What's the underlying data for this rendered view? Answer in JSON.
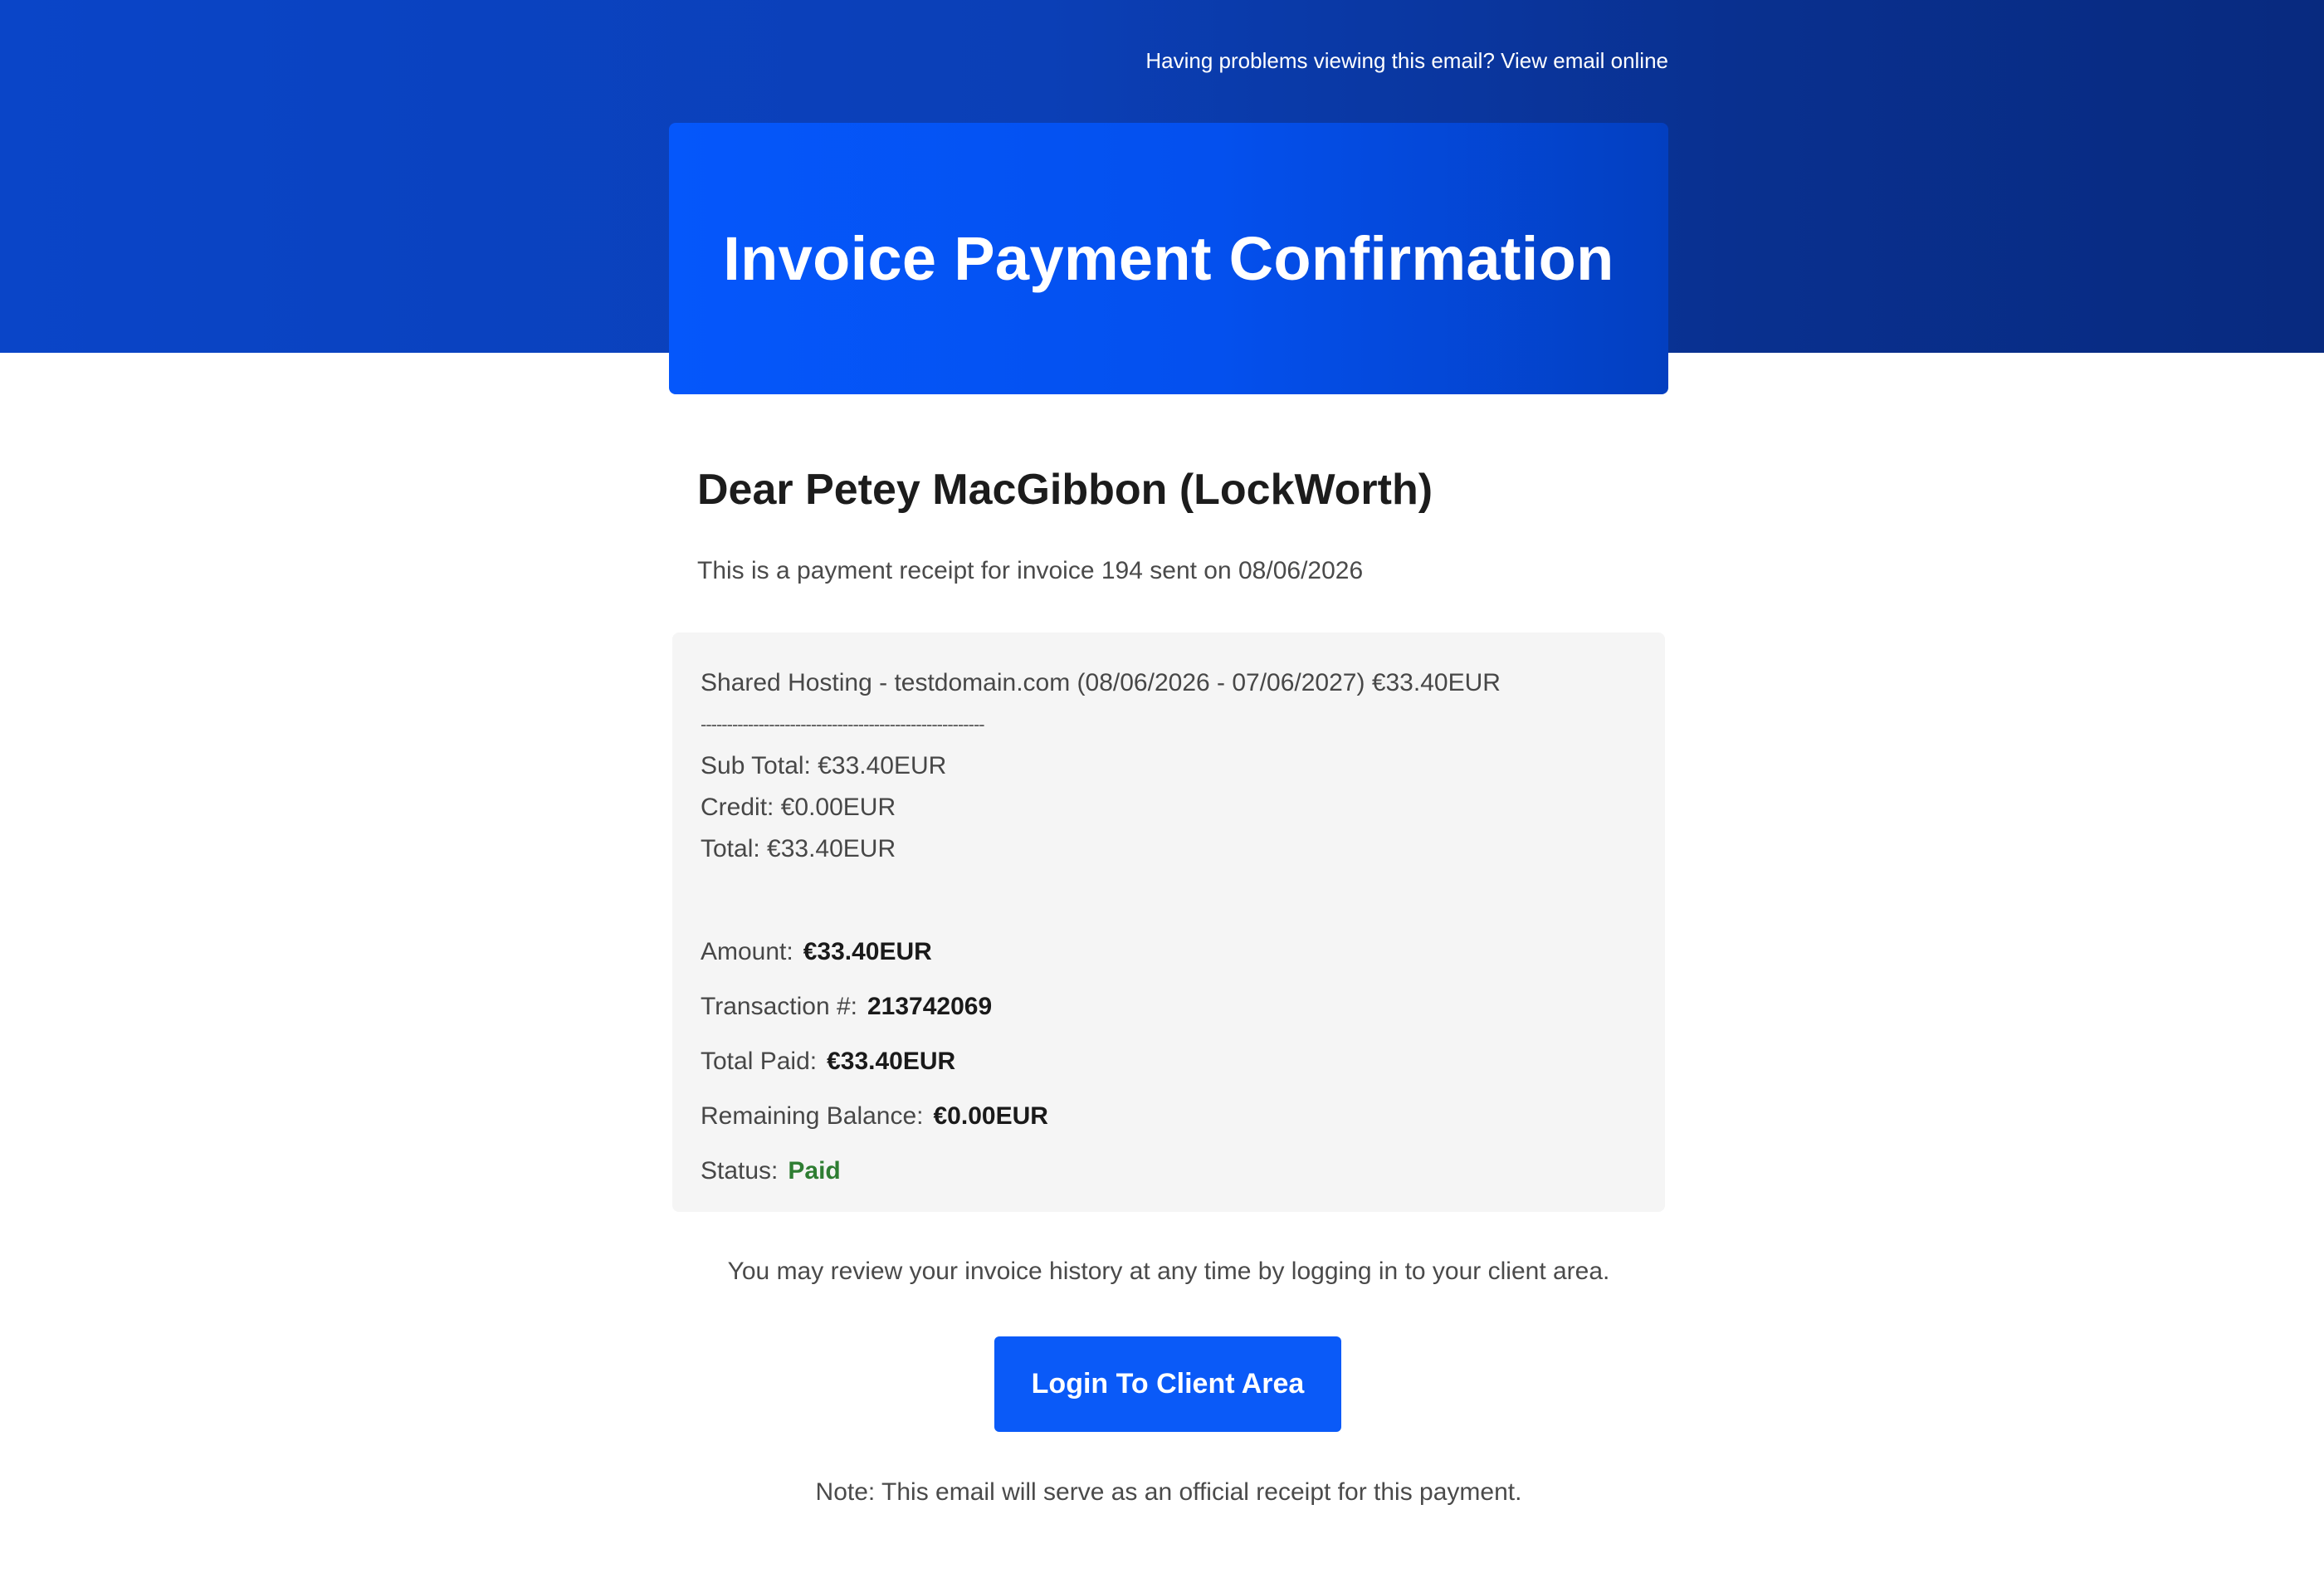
{
  "preheader": {
    "text": "Having problems viewing this email?",
    "link": "View email online"
  },
  "hero": {
    "title": "Invoice Payment Confirmation"
  },
  "greeting": "Dear Petey MacGibbon (LockWorth)",
  "intro": "This is a payment receipt for invoice 194 sent on 08/06/2026",
  "invoice": {
    "line_item": "Shared Hosting - testdomain.com (08/06/2026 - 07/06/2027) €33.40EUR",
    "separator": "------------------------------------------------------",
    "sub_total": "Sub Total: €33.40EUR",
    "credit": "Credit: €0.00EUR",
    "total": "Total: €33.40EUR"
  },
  "payment": {
    "amount_label": "Amount:",
    "amount_value": "€33.40EUR",
    "transaction_label": "Transaction #:",
    "transaction_value": "213742069",
    "total_paid_label": "Total Paid:",
    "total_paid_value": "€33.40EUR",
    "remaining_label": "Remaining Balance:",
    "remaining_value": "€0.00EUR",
    "status_label": "Status:",
    "status_value": "Paid"
  },
  "review_text": "You may review your invoice history at any time by logging in to your client area.",
  "login_button": "Login To Client Area",
  "note": "Note: This email will serve as an official receipt for this payment.",
  "colors": {
    "header_band": "#0b3fb6",
    "hero": "#0557fb",
    "button": "#0a5af8",
    "paid": "#2e7d32",
    "panel": "#f5f5f5"
  }
}
